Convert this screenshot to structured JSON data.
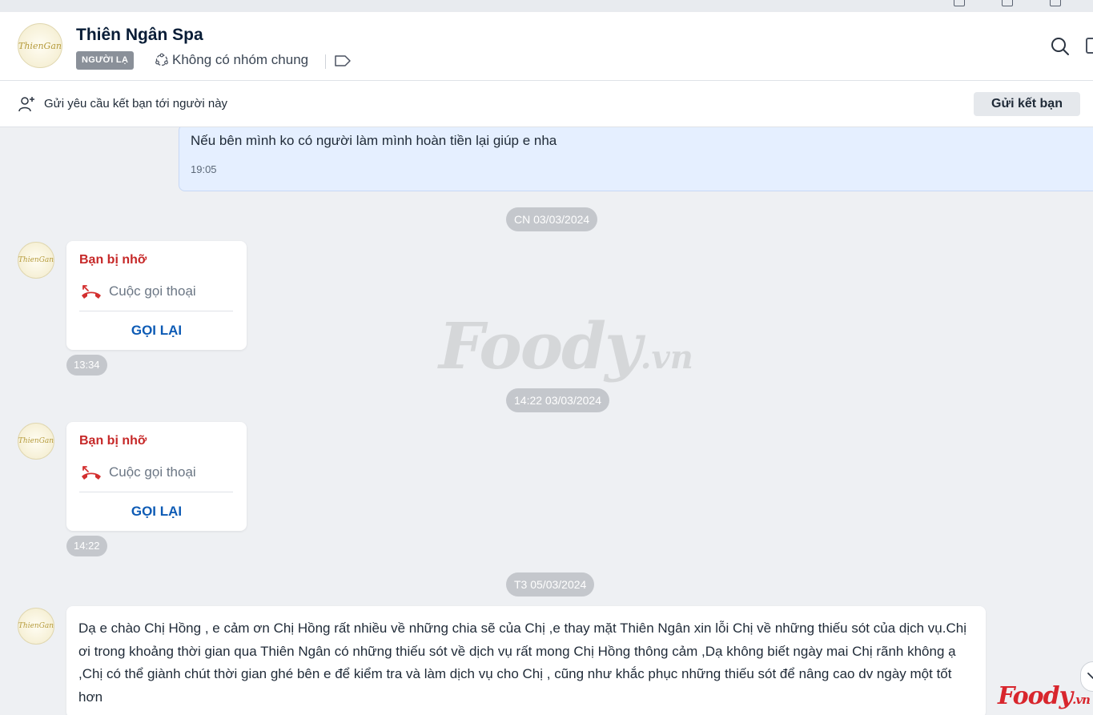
{
  "header": {
    "title": "Thiên Ngân Spa",
    "badge": "NGƯỜI LẠ",
    "group_text": "Không có nhóm chung",
    "avatar_logo": "ThienGan",
    "icons": [
      "group-icon",
      "tag-icon",
      "search-icon"
    ]
  },
  "friend_bar": {
    "text": "Gửi yêu cầu kết bạn tới người này",
    "button_label": "Gửi kết bạn"
  },
  "messages": {
    "my_message": {
      "text": "Nếu bên mình ko có người làm mình hoàn tiền lại giúp e nha",
      "time": "19:05"
    },
    "date_separators": [
      "CN 03/03/2024",
      "14:22 03/03/2024",
      "T3 05/03/2024"
    ],
    "missed_calls": [
      {
        "status": "Bạn bị nhỡ",
        "type": "Cuộc gọi thoại",
        "action": "GỌI LẠI",
        "time": "13:34"
      },
      {
        "status": "Bạn bị nhỡ",
        "type": "Cuộc gọi thoại",
        "action": "GỌI LẠI",
        "time": "14:22"
      }
    ],
    "long_message": {
      "text": "Dạ e chào Chị Hồng , e cảm ơn Chị Hồng rất nhiều về những chia sẽ của Chị ,e thay mặt Thiên Ngân xin lỗi Chị về những thiếu sót của dịch vụ.Chị ơi trong khoảng thời gian qua Thiên Ngân có những thiếu sót về dịch vụ rất mong Chị Hồng thông cảm ,Dạ không biết ngày mai Chị rãnh không ạ ,Chị có thể giành chút thời gian ghé bên e để kiểm tra và làm dịch vụ cho Chị , cũng như khắc phục những thiếu sót để nâng cao dv ngày một tốt hơn"
    }
  },
  "watermark": {
    "main": "Foody",
    "suffix": ".vn"
  },
  "brand_corner": {
    "main": "Foody",
    "suffix": ".vn"
  },
  "colors": {
    "accent": "#0d5bb5",
    "missed": "#c62828",
    "my_bubble": "#e5efff",
    "brand": "#d8262d"
  }
}
